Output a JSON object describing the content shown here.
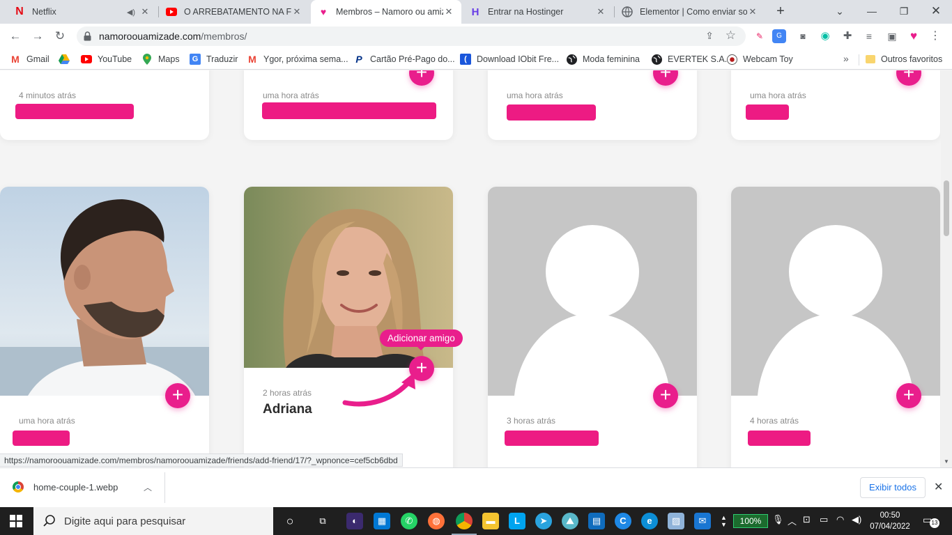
{
  "browser": {
    "tabs": [
      {
        "title": "Netflix",
        "favicon": "N",
        "active": false,
        "audio": true
      },
      {
        "title": "O ARREBATAMENTO NA FEST",
        "favicon": "yt",
        "active": false
      },
      {
        "title": "Membros – Namoro ou amiz",
        "favicon": "heart",
        "active": true
      },
      {
        "title": "Entrar na Hostinger",
        "favicon": "H",
        "active": false
      },
      {
        "title": "Elementor | Como enviar soli",
        "favicon": "globe",
        "active": false
      }
    ],
    "url_host": "namoroouamizade.com",
    "url_path": "/membros/",
    "bookmarks": [
      {
        "label": "Gmail",
        "icon": "M",
        "color": "#ea4335"
      },
      {
        "label": "",
        "icon": "drive",
        "color": "#f4b400"
      },
      {
        "label": "YouTube",
        "icon": "▶",
        "color": "#ff0000"
      },
      {
        "label": "Maps",
        "icon": "pin",
        "color": "#34a853"
      },
      {
        "label": "Traduzir",
        "icon": "G",
        "color": "#4285f4"
      },
      {
        "label": "Ygor, próxima sema...",
        "icon": "M",
        "color": "#ea4335"
      },
      {
        "label": "Cartão Pré-Pago do...",
        "icon": "P",
        "color": "#003087"
      },
      {
        "label": "Download IObit Fre...",
        "icon": "(",
        "color": "#1a56db"
      },
      {
        "label": "Moda feminina",
        "icon": "globe",
        "color": "#202124"
      },
      {
        "label": "EVERTEK S.A.",
        "icon": "globe",
        "color": "#202124"
      },
      {
        "label": "Webcam Toy",
        "icon": "cam",
        "color": "#b71c1c"
      }
    ],
    "other_bookmarks": "Outros favoritos",
    "status_url": "https://namoroouamizade.com/membros/namoroouamizade/friends/add-friend/17/?_wpnonce=cef5cb6dbd"
  },
  "members_top": [
    {
      "time": "4 minutos atrás"
    },
    {
      "time": "uma hora atrás"
    },
    {
      "time": "uma hora atrás"
    },
    {
      "time": "uma hora atrás"
    }
  ],
  "members": [
    {
      "time": "uma hora atrás",
      "name": "",
      "photo": "man"
    },
    {
      "time": "2 horas atrás",
      "name": "Adriana",
      "photo": "woman"
    },
    {
      "time": "3 horas atrás",
      "name": "",
      "photo": "placeholder"
    },
    {
      "time": "4 horas atrás",
      "name": "",
      "photo": "placeholder"
    }
  ],
  "tooltip": "Adicionar amigo",
  "downloads": {
    "file": "home-couple-1.webp",
    "show_all": "Exibir todos"
  },
  "taskbar": {
    "search_placeholder": "Digite aqui para pesquisar",
    "battery": "100%",
    "time": "00:50",
    "date": "07/04/2022",
    "notifications": "13"
  },
  "colors": {
    "accent": "#e91e8c",
    "name_bar": "#ed1b83"
  }
}
